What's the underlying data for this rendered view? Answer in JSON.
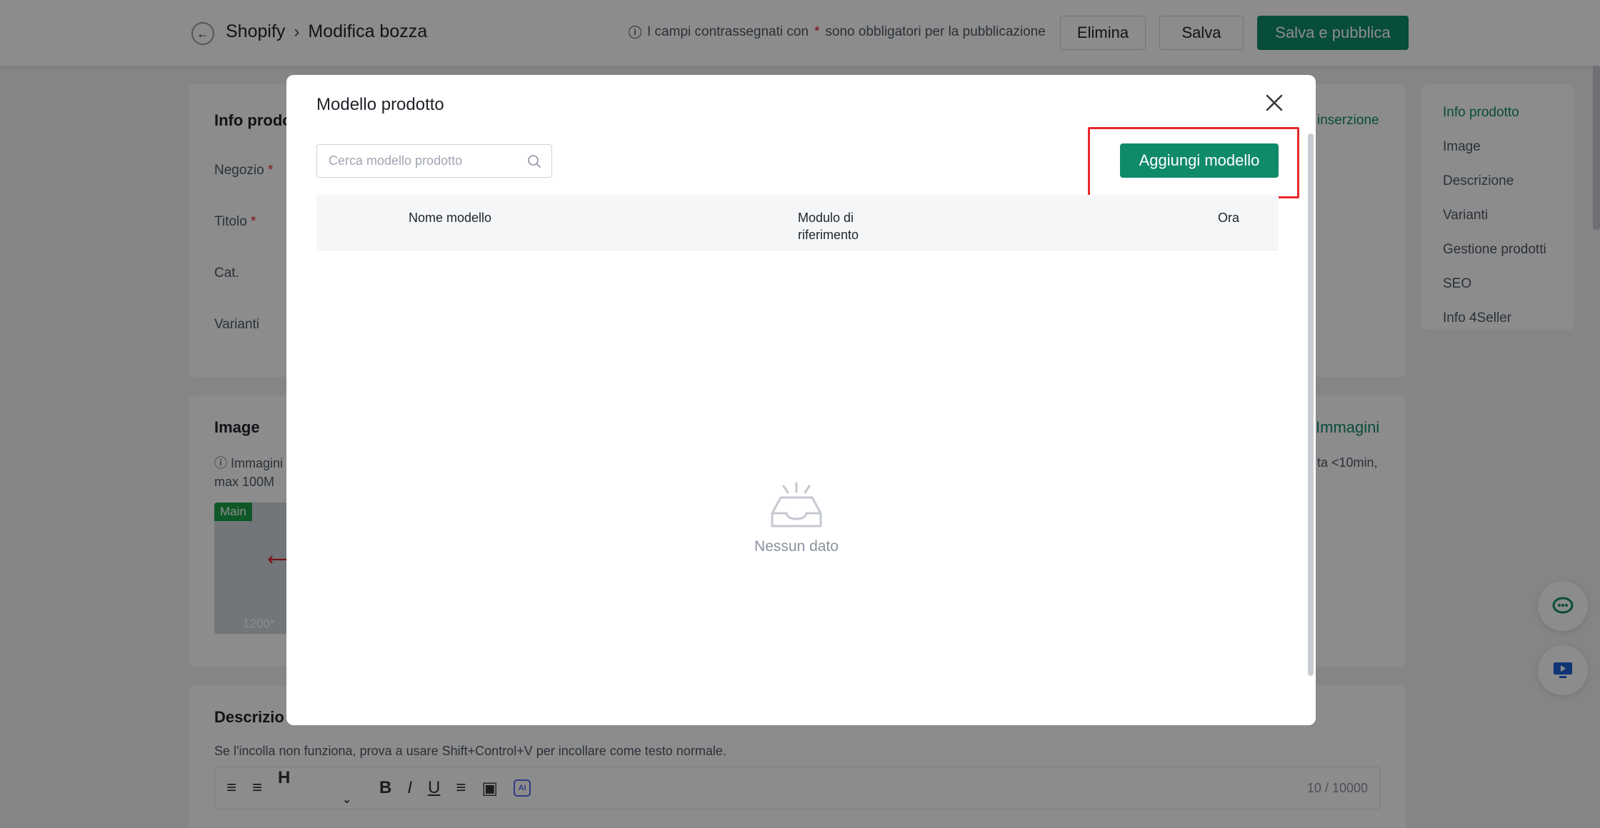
{
  "header": {
    "breadcrumb_root": "Shopify",
    "breadcrumb_current": "Modifica bozza",
    "notice_prefix": "I campi contrassegnati con",
    "notice_star": "*",
    "notice_suffix": "sono obbligatori per la pubblicazione",
    "delete_label": "Elimina",
    "save_label": "Salva",
    "publish_label": "Salva e pubblica"
  },
  "info_card": {
    "title": "Info prodo",
    "fields": [
      "Negozio",
      "Titolo",
      "Cat.",
      "Varianti"
    ],
    "required_mark": "*",
    "right_link": "inserzione"
  },
  "image_card": {
    "title": "Image",
    "note": "Immagini max 100M",
    "right_link": "Immagini",
    "right_note": "ta <10min,",
    "thumb_tag": "Main",
    "thumb_size": "1200*"
  },
  "desc_card": {
    "title": "Descrizio",
    "hint": "Se l'incolla non funziona, prova a usare Shift+Control+V per incollare come testo normale.",
    "heading_glyph": "H",
    "counter": "10 / 10000"
  },
  "side_nav": {
    "items": [
      "Info prodotto",
      "Image",
      "Descrizione",
      "Varianti",
      "Gestione prodotti",
      "SEO",
      "Info 4Seller"
    ]
  },
  "modal": {
    "title": "Modello prodotto",
    "search_placeholder": "Cerca modello prodotto",
    "add_label": "Aggiungi modello",
    "columns": {
      "name": "Nome modello",
      "module_line1": "Modulo di",
      "module_line2": "riferimento",
      "time": "Ora"
    },
    "empty_text": "Nessun dato"
  },
  "colors": {
    "accent": "#0f8a6b",
    "highlight": "#e8282d",
    "required": "#e5202f"
  }
}
